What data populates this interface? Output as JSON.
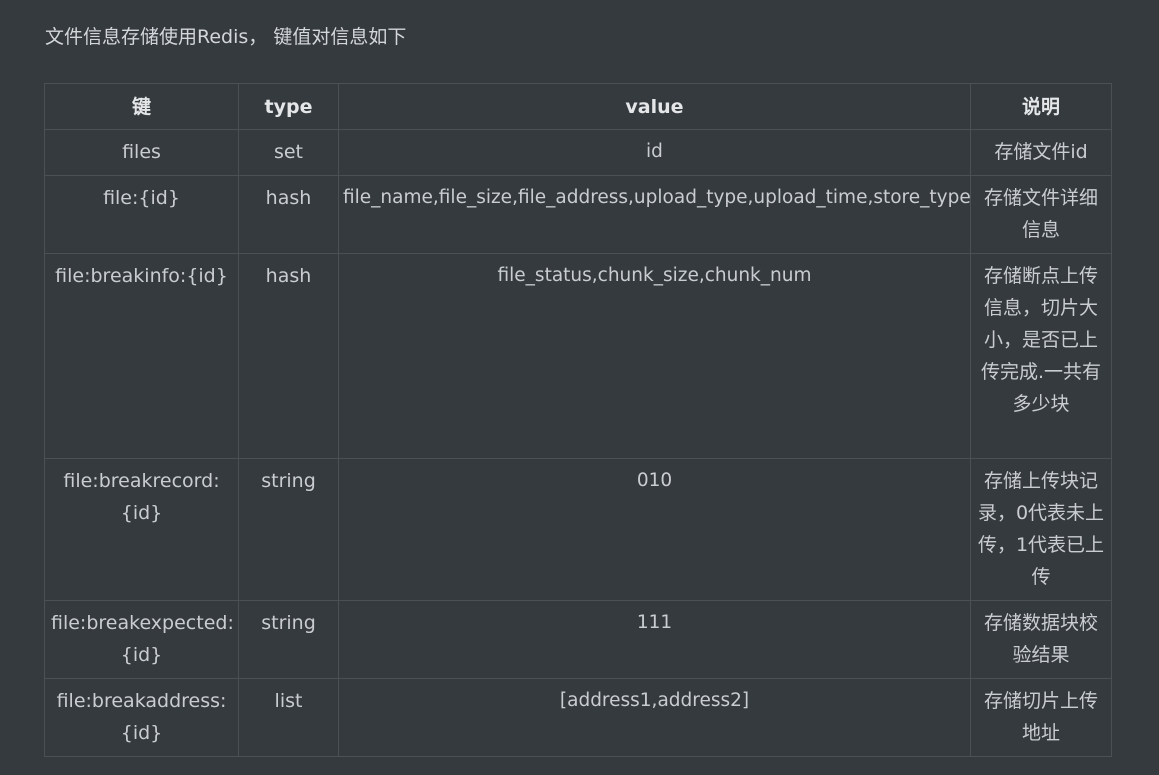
{
  "intro": "文件信息存储使用Redis， 键值对信息如下",
  "table": {
    "headers": [
      "键",
      "type",
      "value",
      "说明"
    ],
    "rows": [
      {
        "key": "files",
        "type": "set",
        "value": "id",
        "desc": "存储文件id"
      },
      {
        "key": "file:{id}",
        "type": "hash",
        "value": "file_name,file_size,file_address,upload_type,upload_time,store_type",
        "desc": "存储文件详细信息"
      },
      {
        "key": "file:breakinfo:{id}",
        "type": "hash",
        "value": "file_status,chunk_size,chunk_num",
        "desc": "存储断点上传信息，切片大小，是否已上传完成.一共有多少块"
      },
      {
        "key": "file:breakrecord:{id}",
        "type": "string",
        "value": "010",
        "desc": "存储上传块记录，0代表未上传，1代表已上传"
      },
      {
        "key": "file:breakexpected:{id}",
        "type": "string",
        "value": "111",
        "desc": "存储数据块校验结果"
      },
      {
        "key": "file:breakaddress:{id}",
        "type": "list",
        "value": "[address1,address2]",
        "desc": "存储切片上传地址"
      }
    ]
  }
}
